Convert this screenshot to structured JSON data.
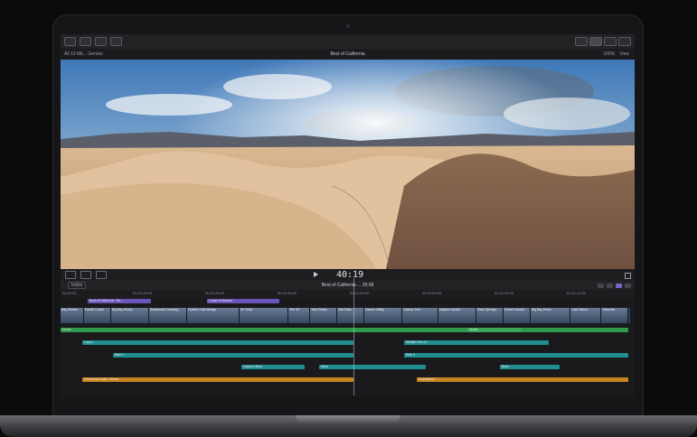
{
  "window": {
    "library": "All 13 Mb... Genres",
    "project_title": "Best of California",
    "zoom": "100%",
    "view_menu": "View"
  },
  "transport": {
    "timecode": "40:19"
  },
  "timeline": {
    "index_label": "Index",
    "title": "Best of California",
    "sub_title": "... 20:08",
    "ruler": [
      "00:00:00",
      "00:00:10:00",
      "00:00:20:00",
      "00:00:30:00",
      "00:00:40:00",
      "00:00:50:00",
      "00:01:00:00",
      "00:01:10:00",
      "00:01:20:00"
    ],
    "title_lane": [
      {
        "label": "Best of California - Wi..."
      },
      {
        "label": "Coast of Nevada"
      }
    ],
    "clips": [
      {
        "label": "Bay Shores"
      },
      {
        "label": "Pacific Coast"
      },
      {
        "label": "Big Bay Rocks"
      },
      {
        "label": "Redwoods Crossing"
      },
      {
        "label": "Golden Gate Bridge"
      },
      {
        "label": "SF Dusk"
      },
      {
        "label": "Pier 39"
      },
      {
        "label": "Twin Peaks"
      },
      {
        "label": "Salt Flats"
      },
      {
        "label": "Owens Valley"
      },
      {
        "label": "Joshua Tree"
      },
      {
        "label": "Mojave Sunset"
      },
      {
        "label": "Palm Springs"
      },
      {
        "label": "Desert Sunset"
      },
      {
        "label": "Big Bay Pines"
      },
      {
        "label": "Lake Tahoe"
      },
      {
        "label": "Yosemite"
      }
    ],
    "green_lane": [
      {
        "label": "Drone"
      },
      {
        "label": "Drone"
      }
    ],
    "teal_lane_1": [
      {
        "label": "Loop 1"
      },
      {
        "label": "Wildlife Pan 02"
      }
    ],
    "teal_lane_2": [
      {
        "label": "Ride 2"
      },
      {
        "label": "Ride 3"
      }
    ],
    "teal_lane_3": [
      {
        "label": "Canyon Wind"
      },
      {
        "label": "Wind"
      },
      {
        "label": "Birds"
      }
    ],
    "orange_lane": [
      {
        "label": "Soundtrack Main Theme"
      },
      {
        "label": "Soundtrack"
      }
    ]
  }
}
